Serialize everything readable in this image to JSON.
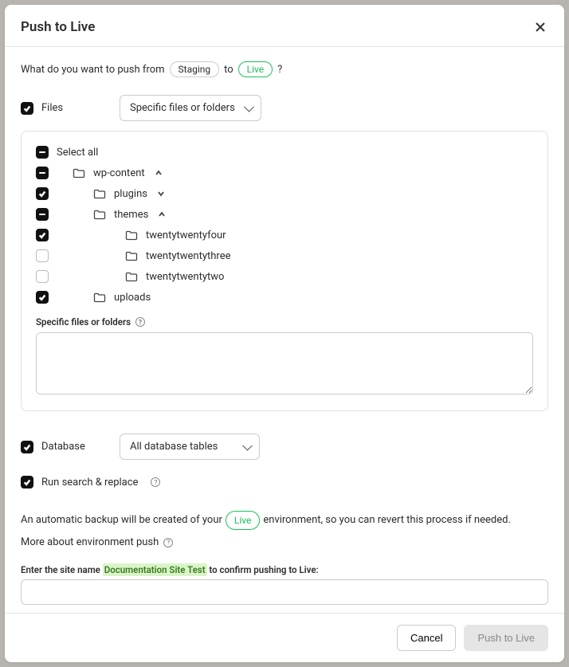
{
  "modal": {
    "title": "Push to Live",
    "question_prefix": "What do you want to push from",
    "source_env": "Staging",
    "to": "to",
    "target_env": "Live",
    "question_suffix": "?"
  },
  "files": {
    "label": "Files",
    "select_value": "Specific files or folders",
    "select_all": "Select all",
    "tree": {
      "wp_content": "wp-content",
      "plugins": "plugins",
      "themes": "themes",
      "twentytwentyfour": "twentytwentyfour",
      "twentytwentythree": "twentytwentythree",
      "twentytwentytwo": "twentytwentytwo",
      "uploads": "uploads"
    },
    "specific_label": "Specific files or folders"
  },
  "database": {
    "label": "Database",
    "select_value": "All database tables"
  },
  "search_replace": {
    "label": "Run search & replace"
  },
  "backup": {
    "prefix": "An automatic backup will be created of your",
    "env": "Live",
    "suffix": "environment, so you can revert this process if needed."
  },
  "more_about": "More about environment push",
  "confirm": {
    "prefix": "Enter the site name ",
    "site_name": "Documentation Site Test",
    "suffix": " to confirm pushing to Live:"
  },
  "footer": {
    "cancel": "Cancel",
    "push": "Push to Live"
  }
}
